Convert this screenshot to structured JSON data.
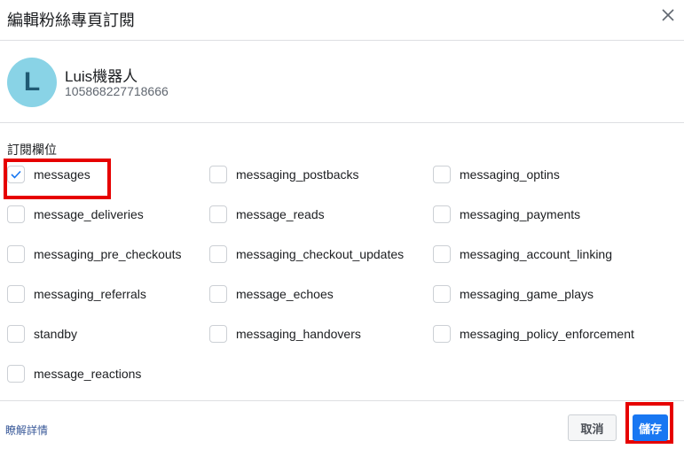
{
  "dialog": {
    "title": "編輯粉絲專頁訂閱"
  },
  "profile": {
    "avatar_letter": "L",
    "name": "Luis機器人",
    "id": "105868227718666"
  },
  "fields": {
    "section_label": "訂閱欄位",
    "checkboxes": [
      {
        "label": "messages",
        "checked": true
      },
      {
        "label": "messaging_postbacks",
        "checked": false
      },
      {
        "label": "messaging_optins",
        "checked": false
      },
      {
        "label": "message_deliveries",
        "checked": false
      },
      {
        "label": "message_reads",
        "checked": false
      },
      {
        "label": "messaging_payments",
        "checked": false
      },
      {
        "label": "messaging_pre_checkouts",
        "checked": false
      },
      {
        "label": "messaging_checkout_updates",
        "checked": false
      },
      {
        "label": "messaging_account_linking",
        "checked": false
      },
      {
        "label": "messaging_referrals",
        "checked": false
      },
      {
        "label": "message_echoes",
        "checked": false
      },
      {
        "label": "messaging_game_plays",
        "checked": false
      },
      {
        "label": "standby",
        "checked": false
      },
      {
        "label": "messaging_handovers",
        "checked": false
      },
      {
        "label": "messaging_policy_enforcement",
        "checked": false
      },
      {
        "label": "message_reactions",
        "checked": false
      }
    ]
  },
  "footer": {
    "learn_more": "瞭解詳情",
    "cancel_label": "取消",
    "save_label": "儲存"
  },
  "colors": {
    "accent": "#1877f2",
    "highlight": "#e60000",
    "avatar_bg": "#89d3e6"
  }
}
